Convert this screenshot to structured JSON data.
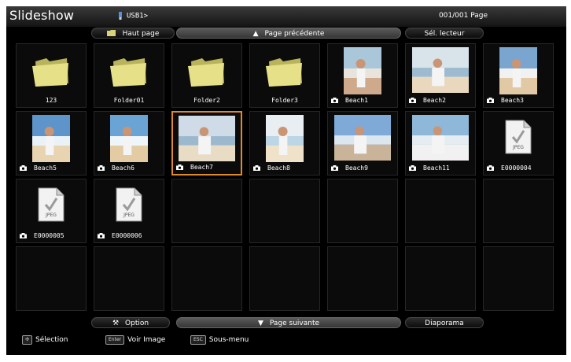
{
  "header": {
    "app_title": "Slideshow",
    "source_label": "USB1>",
    "page_counter": "001/001 Page"
  },
  "top_nav": {
    "home_label": "Haut page",
    "prev_label": "Page précédente",
    "device_label": "Sél. lecteur"
  },
  "grid": {
    "items": [
      {
        "label": "123",
        "kind": "folder"
      },
      {
        "label": "Folder01",
        "kind": "folder"
      },
      {
        "label": "Folder2",
        "kind": "folder"
      },
      {
        "label": "Folder3",
        "kind": "folder"
      },
      {
        "label": "Beach1",
        "kind": "photo"
      },
      {
        "label": "Beach2",
        "kind": "photo"
      },
      {
        "label": "Beach3",
        "kind": "photo"
      },
      {
        "label": "Beach5",
        "kind": "photo"
      },
      {
        "label": "Beach6",
        "kind": "photo"
      },
      {
        "label": "Beach7",
        "kind": "photo",
        "selected": true
      },
      {
        "label": "Beach8",
        "kind": "photo"
      },
      {
        "label": "Beach9",
        "kind": "photo"
      },
      {
        "label": "Beach11",
        "kind": "photo"
      },
      {
        "label": "E0000004",
        "kind": "jpeg"
      },
      {
        "label": "E0000005",
        "kind": "jpeg"
      },
      {
        "label": "E0000006",
        "kind": "jpeg"
      }
    ],
    "jpeg_badge": "JPEG"
  },
  "bottom_nav": {
    "option_label": "Option",
    "next_label": "Page suivante",
    "slideshow_label": "Diaporama"
  },
  "help": {
    "select_label": "Sélection",
    "enter_key": "Enter",
    "enter_label": "Voir Image",
    "esc_key": "ESC",
    "esc_label": "Sous-menu"
  },
  "colors": {
    "background": "#000000",
    "selection": "#e08a2c",
    "folder": "#d8d37a"
  }
}
